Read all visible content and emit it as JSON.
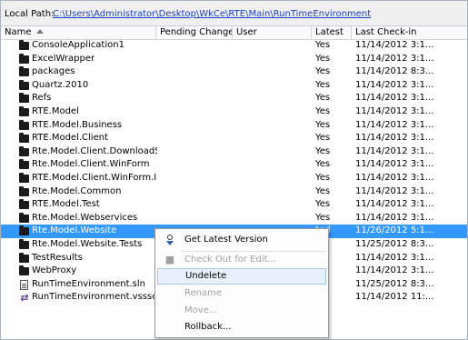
{
  "local_path": {
    "label": "Local Path:",
    "link": "C:\\Users\\Administrator\\Desktop\\WkCe\\RTE\\Main\\RunTimeEnvironment"
  },
  "columns": {
    "name": "Name",
    "pending": "Pending Change",
    "user": "User",
    "latest": "Latest",
    "checkin": "Last Check-in"
  },
  "rows": [
    {
      "icon": "folder-icon",
      "name": "ConsoleApplication1",
      "pending": "",
      "user": "",
      "latest": "Yes",
      "checkin": "11/14/2012 3:1..."
    },
    {
      "icon": "folder-icon",
      "name": "ExcelWrapper",
      "pending": "",
      "user": "",
      "latest": "Yes",
      "checkin": "11/14/2012 3:1..."
    },
    {
      "icon": "folder-icon",
      "name": "packages",
      "pending": "",
      "user": "",
      "latest": "Yes",
      "checkin": "11/14/2012 8:3..."
    },
    {
      "icon": "folder-icon",
      "name": "Quartz.2010",
      "pending": "",
      "user": "",
      "latest": "Yes",
      "checkin": "11/14/2012 3:1..."
    },
    {
      "icon": "folder-icon",
      "name": "Refs",
      "pending": "",
      "user": "",
      "latest": "Yes",
      "checkin": "11/14/2012 3:1..."
    },
    {
      "icon": "folder-icon",
      "name": "RTE.Model",
      "pending": "",
      "user": "",
      "latest": "Yes",
      "checkin": "11/14/2012 3:1..."
    },
    {
      "icon": "folder-icon",
      "name": "RTE.Model.Business",
      "pending": "",
      "user": "",
      "latest": "Yes",
      "checkin": "11/14/2012 3:1..."
    },
    {
      "icon": "folder-icon",
      "name": "RTE.Model.Client",
      "pending": "",
      "user": "",
      "latest": "Yes",
      "checkin": "11/14/2012 3:1..."
    },
    {
      "icon": "folder-icon",
      "name": "Rte.Model.Client.DownloadSh...",
      "pending": "",
      "user": "",
      "latest": "Yes",
      "checkin": "11/14/2012 3:1..."
    },
    {
      "icon": "folder-icon",
      "name": "Rte.Model.Client.WinForm",
      "pending": "",
      "user": "",
      "latest": "Yes",
      "checkin": "11/14/2012 3:1..."
    },
    {
      "icon": "folder-icon",
      "name": "RTE.Model.Client.WinForm.Ins...",
      "pending": "",
      "user": "",
      "latest": "Yes",
      "checkin": "11/14/2012 3:1..."
    },
    {
      "icon": "folder-icon",
      "name": "Rte.Model.Common",
      "pending": "",
      "user": "",
      "latest": "Yes",
      "checkin": "11/14/2012 3:1..."
    },
    {
      "icon": "folder-icon",
      "name": "RTE.Model.Test",
      "pending": "",
      "user": "",
      "latest": "Yes",
      "checkin": "11/14/2012 3:1..."
    },
    {
      "icon": "folder-icon",
      "name": "Rte.Model.Webservices",
      "pending": "",
      "user": "",
      "latest": "Yes",
      "checkin": "11/14/2012 3:1..."
    },
    {
      "icon": "folder-icon",
      "name": "Rte.Model.Website",
      "pending": "",
      "user": "",
      "latest": "ted",
      "checkin": "11/26/2012 5:1...",
      "selected": true,
      "deleted": true
    },
    {
      "icon": "folder-icon",
      "name": "Rte.Model.Website.Tests",
      "pending": "",
      "user": "",
      "latest": "",
      "checkin": "11/25/2012 8:3..."
    },
    {
      "icon": "folder-icon",
      "name": "TestResults",
      "pending": "",
      "user": "",
      "latest": "",
      "checkin": "11/14/2012 3:1..."
    },
    {
      "icon": "folder-icon",
      "name": "WebProxy",
      "pending": "",
      "user": "",
      "latest": "",
      "checkin": "11/14/2012 3:1..."
    },
    {
      "icon": "file-icon",
      "name": "RunTimeEnvironment.sln",
      "pending": "",
      "user": "",
      "latest": "",
      "checkin": "11/25/2012 8:3..."
    },
    {
      "icon": "sln-icon",
      "name": "RunTimeEnvironment.vssscc",
      "pending": "",
      "user": "",
      "latest": "",
      "checkin": "11/14/2012 11:..."
    }
  ],
  "context_menu": {
    "items": [
      {
        "label": "Get Latest Version",
        "enabled": true,
        "icon": "get-latest-icon"
      },
      {
        "label": "Check Out for Edit...",
        "enabled": false,
        "icon": "check-out-icon"
      },
      {
        "label": "Undelete",
        "enabled": true,
        "hover": true
      },
      {
        "label": "Rename",
        "enabled": false
      },
      {
        "label": "Move...",
        "enabled": false
      },
      {
        "label": "Rollback...",
        "enabled": true
      }
    ]
  }
}
